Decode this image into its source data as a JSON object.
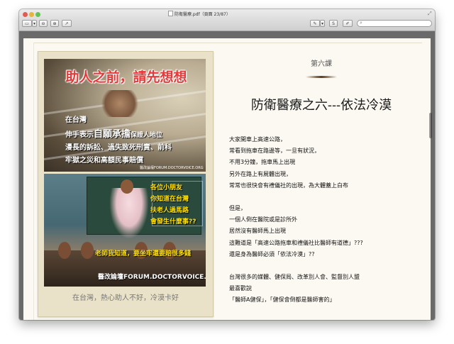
{
  "window": {
    "title": "防衛醫療.pdf（頁面 23/87）"
  },
  "toolbar": {
    "sidebar_icon": "sidebar-icon",
    "zoom_out": "⊖",
    "zoom_in": "⊕",
    "share": "↗",
    "annotate": "✎",
    "sign": "S",
    "edit": "✐",
    "search_placeholder": "",
    "search_icon": "search-icon"
  },
  "poster": {
    "headline": "助人之前，請先想想",
    "line1": "在台灣",
    "line2_pre": "伸手表示",
    "line2_big": "自願承擔",
    "line2_post": "保證人地位",
    "line3": "漫長的訴訟、過失致死刑責、前科",
    "line4": "牢獄之災和高額民事賠償",
    "watermark_top": "醫改論壇FORUM.DOCTORVOICE.ORG",
    "yellow1": "各位小朋友",
    "yellow2": "你知道在台灣",
    "yellow3": "扶老人過馬路",
    "yellow4": "會發生什麼事??",
    "yellow5": "老師我知道，要坐牢還要賠很多錢",
    "watermark_bottom": "醫改論壇FORUM.DOCTORVOICE.ORG",
    "caption": "在台灣，熱心助人不好，冷漠卡好"
  },
  "article": {
    "chapter": "第六課",
    "heading": "防衛醫療之六---依法冷漠",
    "lines": [
      "大家開車上高速公路，",
      "常看到拖車在路邊等，一旦有狀況，",
      "不用3分鐘，拖車馬上出現",
      "另外在路上有屍體出現，",
      "常常也很快會有禮儀社的出現，為大體蓋上白布",
      "但是，",
      "一個人倒在醫院或是診所外",
      "居然沒有醫師馬上出現",
      "這難道是「高速公路拖車和禮儀社比醫師有道德」???",
      "還是身為醫師必須「依法冷漠」??",
      "台灣很多的媒體、健保局、改革別人會、監督別人盟",
      "最喜歡說",
      "「醫師A健保」，「健保會倒都是醫師害的」"
    ]
  }
}
